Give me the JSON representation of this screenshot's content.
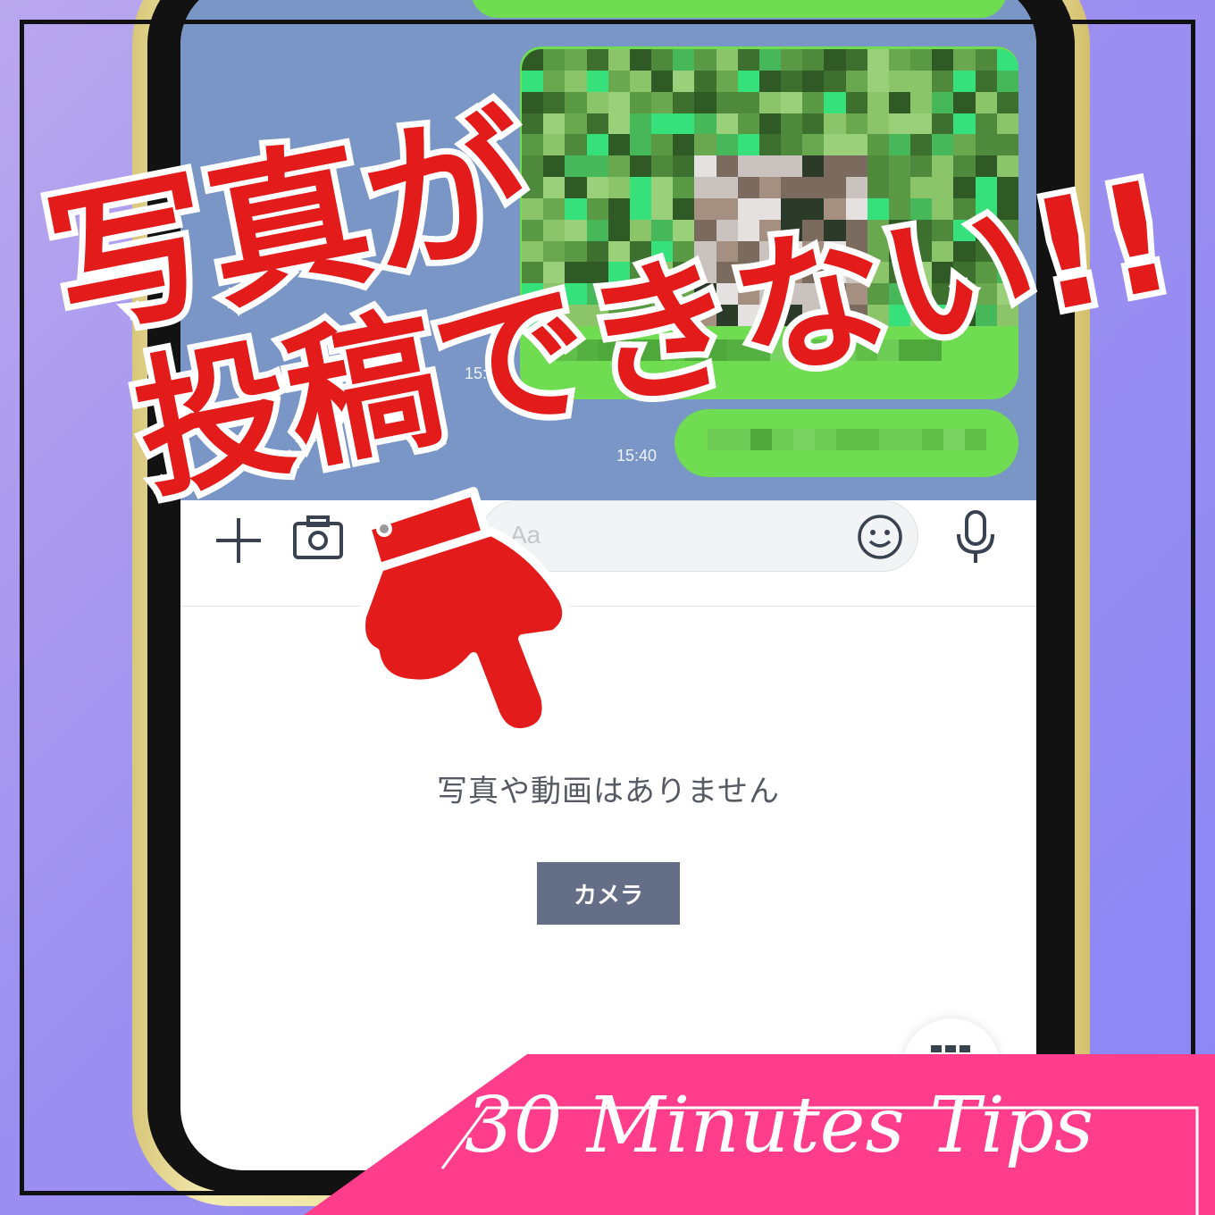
{
  "headline": {
    "line1": "写真が",
    "line2": "投稿できない!!"
  },
  "chat": {
    "times": [
      "15:3",
      "15:40"
    ],
    "message_placeholder": "Aa"
  },
  "gallery": {
    "empty_message": "写真や動画はありません",
    "camera_button": "カメラ"
  },
  "branding": {
    "banner_text": "30 Minutes Tips"
  },
  "colors": {
    "headline_red": "#e41b1b",
    "bubble_green": "#6fdc52",
    "chat_background": "#7a96c6",
    "camera_button": "#646e87",
    "banner_pink": "#ff3d8b"
  },
  "icons": [
    "plus-icon",
    "camera-icon",
    "emoji-icon",
    "microphone-icon",
    "grid-icon",
    "pointing-hand-icon"
  ]
}
